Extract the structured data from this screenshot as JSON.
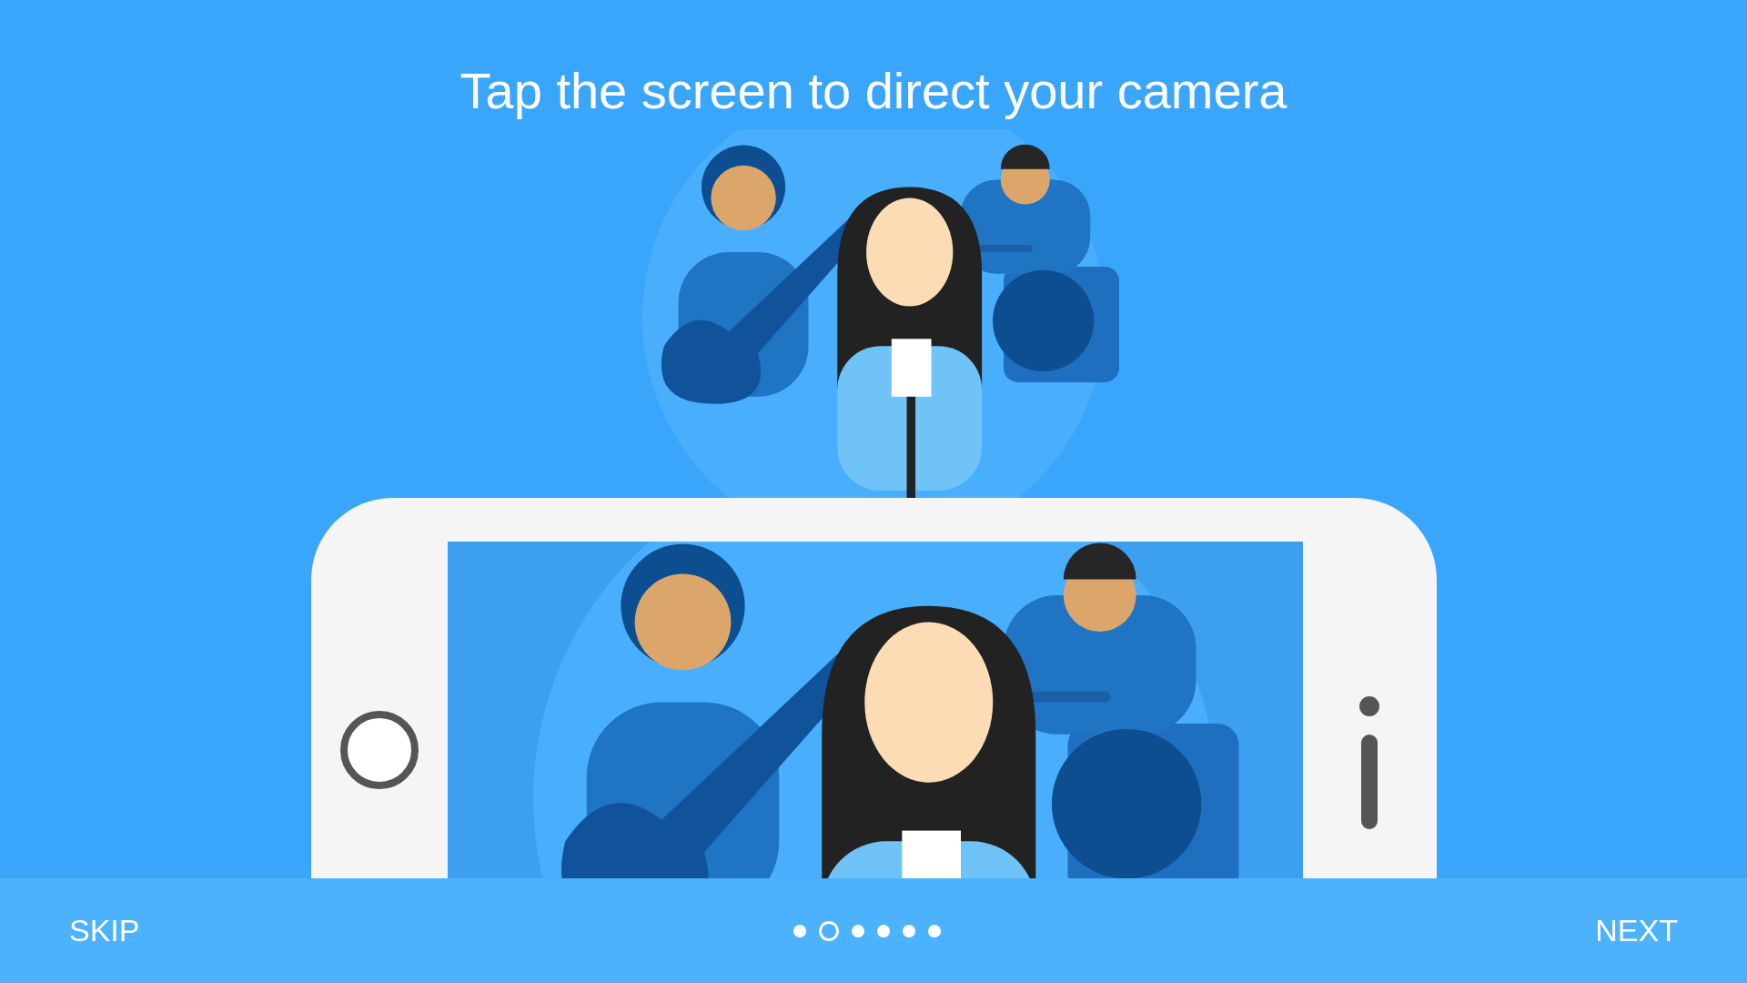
{
  "title": "Tap the screen to direct your camera",
  "footer": {
    "skip": "SKIP",
    "next": "NEXT",
    "dots": [
      {
        "selected": false
      },
      {
        "selected": true
      },
      {
        "selected": false
      },
      {
        "selected": false
      },
      {
        "selected": false
      },
      {
        "selected": false
      }
    ]
  }
}
